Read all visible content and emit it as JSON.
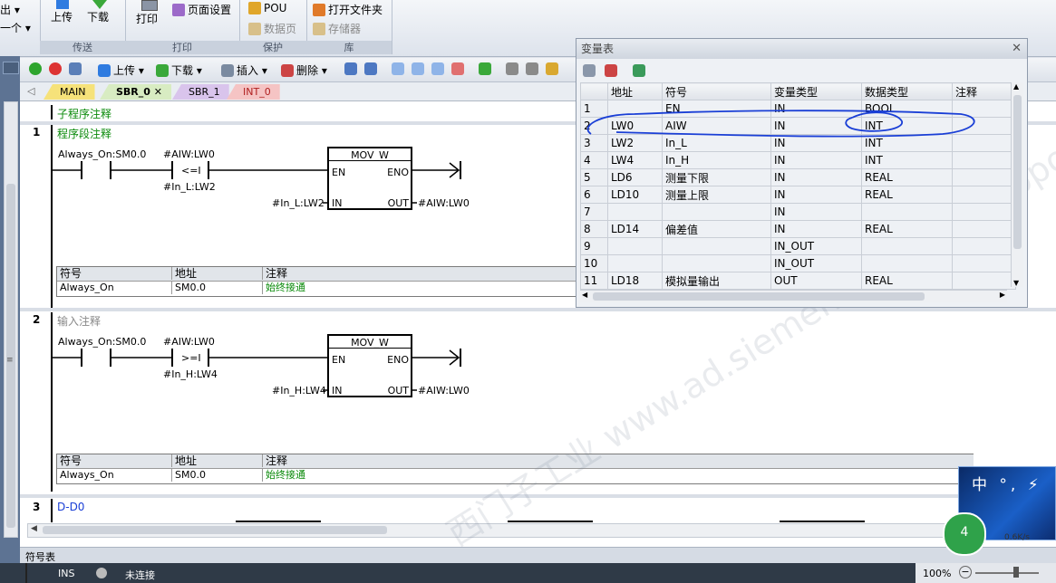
{
  "ribbon": {
    "left_items": [
      "出 ▾",
      "一个 ▾"
    ],
    "transfer": {
      "upload": "上传",
      "download": "下载",
      "group": "传送"
    },
    "print": {
      "print": "打印",
      "page_setup": "页面设置",
      "group": "打印"
    },
    "protect": {
      "pou": "POU",
      "data_page": "数据页",
      "group": "保护"
    },
    "library": {
      "open_folder": "打开文件夹",
      "memory": "存储器",
      "group": "库"
    }
  },
  "toolbar": {
    "upload": "上传",
    "download": "下载",
    "insert": "插入",
    "delete": "删除"
  },
  "tabs": [
    "MAIN",
    "SBR_0",
    "SBR_1",
    "INT_0"
  ],
  "editor": {
    "subroutine_comment": "子程序注释",
    "networks": [
      {
        "no": "1",
        "comment": "程序段注释",
        "contact1": "Always_On:SM0.0",
        "compare_top": "#AIW:LW0",
        "compare_op": "<=I",
        "compare_bottom": "#In_L:LW2",
        "box_title": "MOV_W",
        "en": "EN",
        "eno": "ENO",
        "in": "IN",
        "out": "OUT",
        "in_val": "#In_L:LW2",
        "out_val": "#AIW:LW0",
        "symbol_table": {
          "headers": [
            "符号",
            "地址",
            "注释"
          ],
          "row": [
            "Always_On",
            "SM0.0",
            "始终接通"
          ]
        }
      },
      {
        "no": "2",
        "comment": "输入注释",
        "contact1": "Always_On:SM0.0",
        "compare_top": "#AIW:LW0",
        "compare_op": ">=I",
        "compare_bottom": "#In_H:LW4",
        "box_title": "MOV_W",
        "en": "EN",
        "eno": "ENO",
        "in": "IN",
        "out": "OUT",
        "in_val": "#In_H:LW4",
        "out_val": "#AIW:LW0",
        "symbol_table": {
          "headers": [
            "符号",
            "地址",
            "注释"
          ],
          "row": [
            "Always_On",
            "SM0.0",
            "始终接通"
          ]
        }
      },
      {
        "no": "3",
        "comment": "D-D0"
      }
    ]
  },
  "var_table": {
    "title": "变量表",
    "headers": [
      "",
      "地址",
      "符号",
      "变量类型",
      "数据类型",
      "注释"
    ],
    "rows": [
      [
        "1",
        "",
        "EN",
        "IN",
        "BOOL",
        ""
      ],
      [
        "2",
        "LW0",
        "AIW",
        "IN",
        "INT",
        ""
      ],
      [
        "3",
        "LW2",
        "In_L",
        "IN",
        "INT",
        ""
      ],
      [
        "4",
        "LW4",
        "In_H",
        "IN",
        "INT",
        ""
      ],
      [
        "5",
        "LD6",
        "测量下限",
        "IN",
        "REAL",
        ""
      ],
      [
        "6",
        "LD10",
        "测量上限",
        "IN",
        "REAL",
        ""
      ],
      [
        "7",
        "",
        "",
        "IN",
        "",
        ""
      ],
      [
        "8",
        "LD14",
        "偏差值",
        "IN",
        "REAL",
        ""
      ],
      [
        "9",
        "",
        "",
        "IN_OUT",
        "",
        ""
      ],
      [
        "10",
        "",
        "",
        "IN_OUT",
        "",
        ""
      ],
      [
        "11",
        "LD18",
        "模拟量输出",
        "OUT",
        "REAL",
        ""
      ]
    ]
  },
  "watermark": "西门子工业 www.ad.siemens.com.cn support.industry.siemens.com",
  "bottom_panel": "符号表",
  "status": {
    "mode": "INS",
    "connection": "未连接",
    "zoom": "100%"
  },
  "ime": {
    "text": "中 °, ⚡"
  },
  "net_badge": {
    "value": "4",
    "speed": "0.6K/s"
  },
  "colors": {
    "accent_blue": "#1a3fd6",
    "green_text": "#0a8a0a"
  }
}
